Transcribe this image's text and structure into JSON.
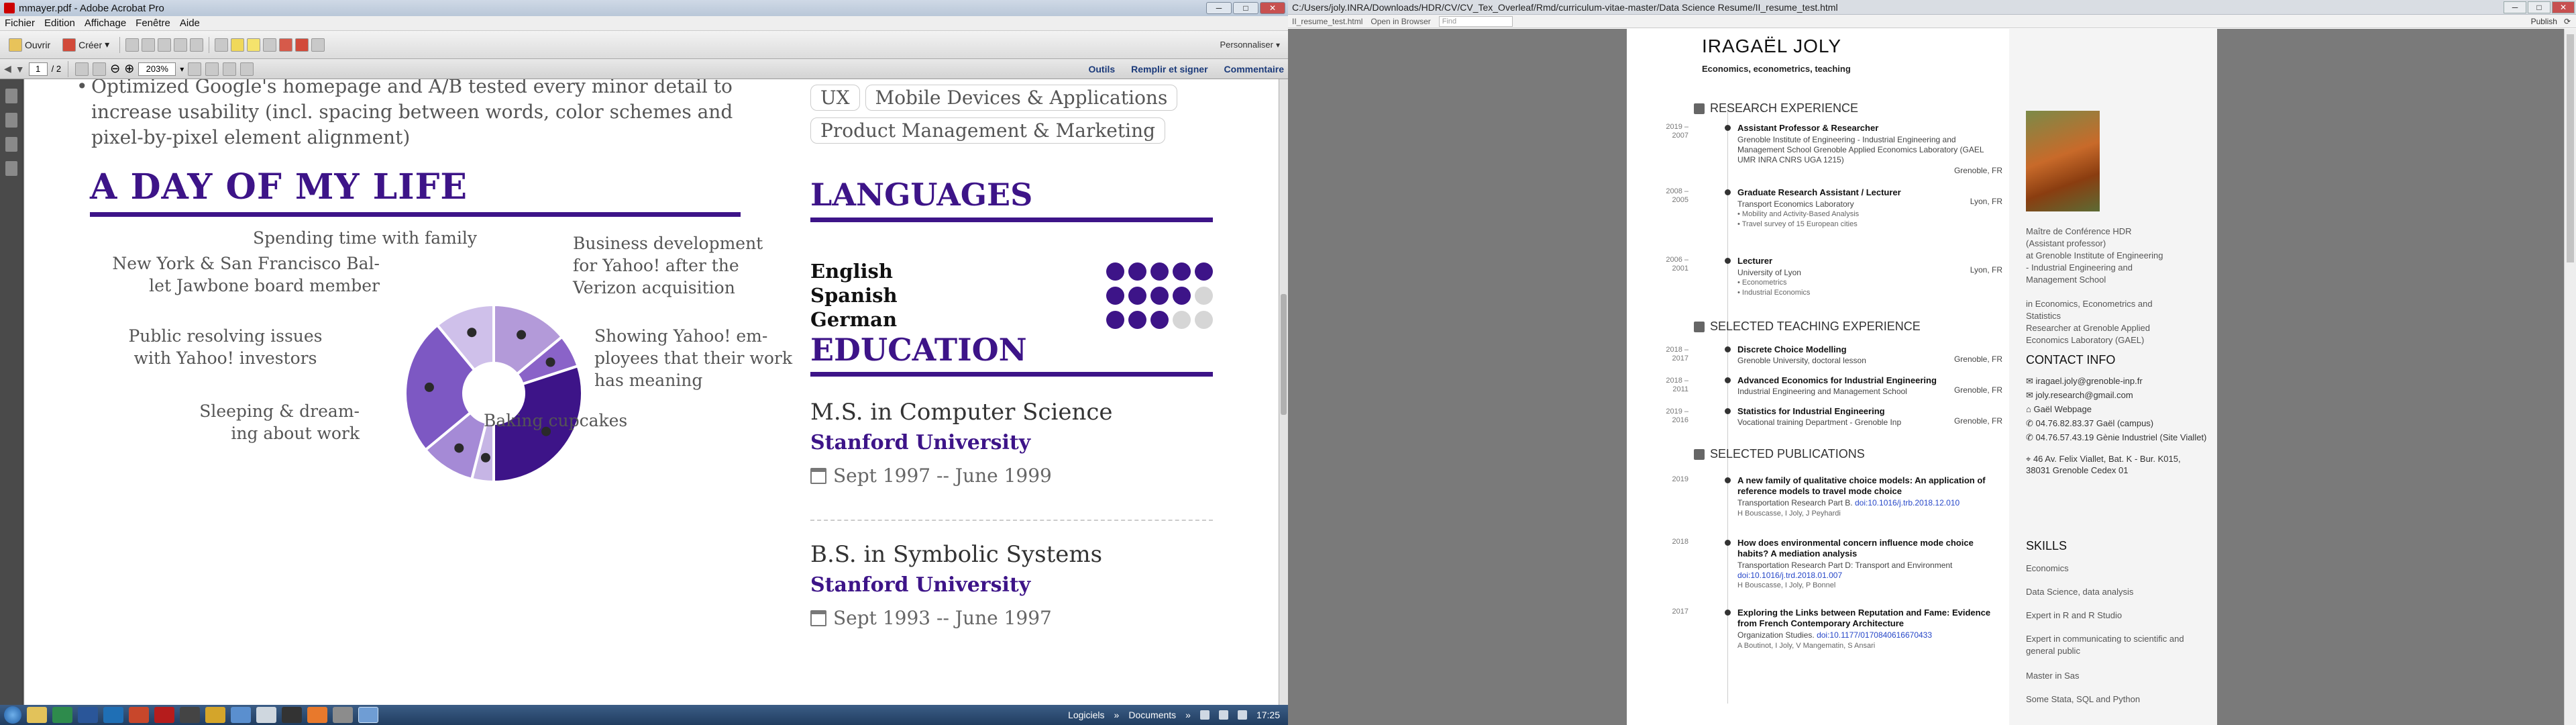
{
  "acrobat": {
    "title": "mmayer.pdf - Adobe Acrobat Pro",
    "menu": [
      "Fichier",
      "Edition",
      "Affichage",
      "Fenêtre",
      "Aide"
    ],
    "toolbar": {
      "open_label": "Ouvrir",
      "create_label": "Créer",
      "personalize": "Personnaliser"
    },
    "nav": {
      "page_current": "1",
      "page_total": "/ 2",
      "zoom": "203%"
    },
    "right_tabs": [
      "Outils",
      "Remplir et signer",
      "Commentaire"
    ]
  },
  "resume": {
    "bullet_text": "Optimized Google's homepage and A/B tested every minor detail to increase usability (incl. spacing between words, color schemes and pixel-by-pixel element alignment)",
    "tags": [
      "UX",
      "Mobile Devices & Applications",
      "Product Management & Marketing"
    ],
    "day_title": "A DAY OF MY LIFE",
    "languages_title": "LANGUAGES",
    "languages": [
      {
        "name": "English",
        "level": 5
      },
      {
        "name": "Spanish",
        "level": 4
      },
      {
        "name": "German",
        "level": 3
      }
    ],
    "education_title": "EDUCATION",
    "education": [
      {
        "degree": "M.S. in Computer Science",
        "school": "Stanford University",
        "dates": "Sept 1997 -- June 1999"
      },
      {
        "degree": "B.S. in Symbolic Systems",
        "school": "Stanford University",
        "dates": "Sept 1993 -- June 1997"
      }
    ]
  },
  "chart_data": {
    "type": "pie",
    "categories": [
      "Spending time with family",
      "Business development for Yahoo! after the Verizon acquisition",
      "Showing Yahoo! employees that their work has meaning",
      "Baking cupcakes",
      "Sleeping & dreaming about work",
      "Public resolving issues with Yahoo! investors",
      "New York & San Francisco Ballet Jawbone board member"
    ],
    "values": [
      14,
      6,
      30,
      4,
      10,
      25,
      11
    ],
    "colors": [
      "#b39ad9",
      "#8a63c8",
      "#3d1488",
      "#c6b5e5",
      "#a58ad6",
      "#7d58c3",
      "#cfc0ea"
    ]
  },
  "chart_labels": [
    {
      "text": "Spending time with family"
    },
    {
      "text": "New York & San Francisco Bal-\nlet Jawbone board member"
    },
    {
      "text": "Business development\nfor Yahoo! after the\nVerizon acquisition"
    },
    {
      "text": "Public resolving issues\nwith Yahoo! investors"
    },
    {
      "text": "Showing Yahoo! em-\nployees that their work\nhas meaning"
    },
    {
      "text": "Sleeping & dream-\ning about work"
    },
    {
      "text": "Baking cupcakes"
    }
  ],
  "taskbar": {
    "items": [
      "Logiciels",
      "Documents"
    ],
    "time": "17:25"
  },
  "browser": {
    "title": "C:/Users/joly.INRA/Downloads/HDR/CV/CV_Tex_Overleaf/Rmd/curriculum-vitae-master/Data Science Resume/II_resume_test.html",
    "tab": "II_resume_test.html",
    "open_in_browser": "Open in Browser",
    "find_placeholder": "Find",
    "publish": "Publish"
  },
  "cv": {
    "name": "IRAGAËL JOLY",
    "subtitle": "Economics, econometrics, teaching",
    "research_title": "RESEARCH EXPERIENCE",
    "research": [
      {
        "years": "2019 –\n2007",
        "title": "Assistant Professor & Researcher",
        "text": "Grenoble Institute of Engineering - Industrial Engineering and Management School Grenoble Applied Economics Laboratory (GAEL UMR INRA CNRS UGA 1215)",
        "loc": "Grenoble, FR",
        "extra": ""
      },
      {
        "years": "2008 –\n2005",
        "title": "Graduate Research Assistant / Lecturer",
        "text": "Transport Economics Laboratory",
        "loc": "Lyon, FR",
        "extra": "• Mobility and Activity-Based Analysis\n• Travel survey of 15 European cities"
      },
      {
        "years": "2006 –\n2001",
        "title": "Lecturer",
        "text": "University of Lyon",
        "loc": "Lyon, FR",
        "extra": "• Econometrics\n• Industrial Economics"
      }
    ],
    "teaching_title": "SELECTED TEACHING EXPERIENCE",
    "teaching": [
      {
        "years": "2018 –\n2017",
        "title": "Discrete Choice Modelling",
        "text": "Grenoble University, doctoral lesson",
        "loc": "Grenoble, FR"
      },
      {
        "years": "2018 –\n2011",
        "title": "Advanced Economics for Industrial Engineering",
        "text": "Industrial Engineering and Management School",
        "loc": "Grenoble, FR"
      },
      {
        "years": "2019 –\n2016",
        "title": "Statistics for Industrial Engineering",
        "text": "Vocational training Department - Grenoble Inp",
        "loc": "Grenoble, FR"
      }
    ],
    "pubs_title": "SELECTED PUBLICATIONS",
    "pubs": [
      {
        "year": "2019",
        "title": "A new family of qualitative choice models: An application of reference models to travel mode choice",
        "journal": "Transportation Research Part B.",
        "doi": "doi:10.1016/j.trb.2018.12.010",
        "authors": "H Bouscasse, I Joly, J Peyhardi"
      },
      {
        "year": "2018",
        "title": "How does environmental concern influence mode choice habits? A mediation analysis",
        "journal": "Transportation Research Part D: Transport and Environment",
        "doi": "doi:10.1016/j.trd.2018.01.007",
        "authors": "H Bouscasse, I Joly, P Bonnel"
      },
      {
        "year": "2017",
        "title": "Exploring the Links between Reputation and Fame: Evidence from French Contemporary Architecture",
        "journal": "Organization Studies.",
        "doi": "doi:10.1177/0170840616670433",
        "authors": "A Boutinot, I Joly, V Mangematin, S Ansari"
      }
    ],
    "sidebar": {
      "about": "Maître de Conférence HDR\n(Assistant professor)\nat Grenoble Institute of Engineering\n- Industrial Engineering and\nManagement School\n\nin Economics, Econometrics and\nStatistics\nResearcher at Grenoble Applied\nEconomics Laboratory (GAEL)",
      "contact_title": "CONTACT INFO",
      "contact": [
        "iragael.joly@grenoble-inp.fr",
        "joly.research@gmail.com",
        "Gaël Webpage",
        "04.76.82.83.37 Gaël (campus)",
        "04.76.57.43.19 Gènie Industriel (Site Viallet)",
        "46 Av. Felix Viallet, Bat. K - Bur. K015, 38031 Grenoble Cedex 01"
      ],
      "skills_title": "SKILLS",
      "skills": [
        "Economics",
        "Data Science, data analysis",
        "Expert in R and R Studio",
        "Expert in communicating to scientific and general public",
        "Master in Sas",
        "Some Stata, SQL and Python"
      ]
    }
  }
}
